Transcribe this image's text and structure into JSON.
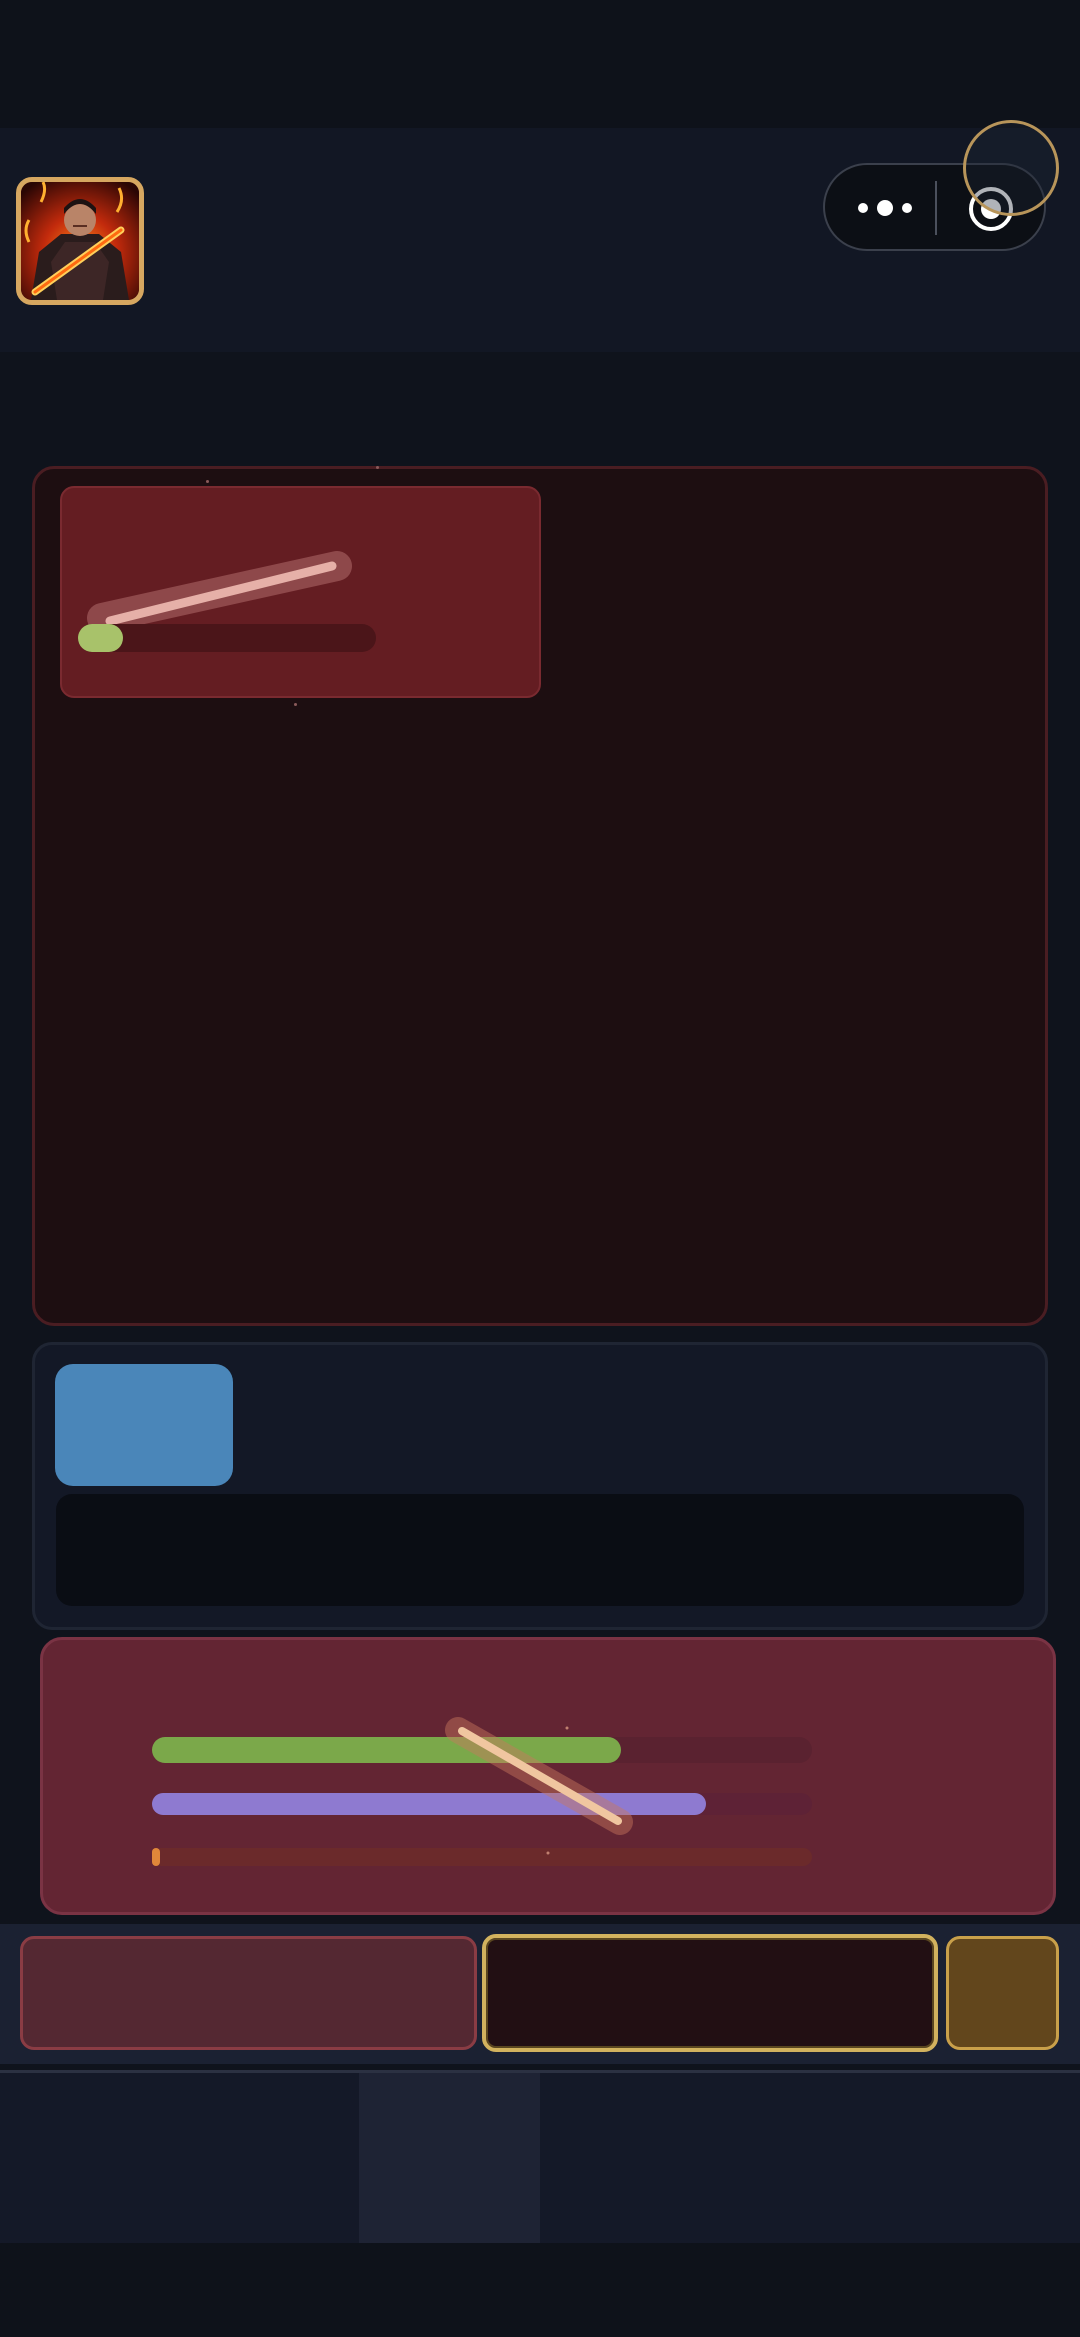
{
  "header": {
    "avatar_icon": "warrior-portrait-icon",
    "capsule": {
      "menu_icon": "more-dots-icon",
      "close_icon": "target-circle-icon"
    }
  },
  "colors": {
    "background": "#0f131c",
    "battle_panel": "#1d0e11",
    "enemy_card": "#641d22",
    "info_chip": "#4a86b9",
    "player_panel": "#632533",
    "hp": "#7ba84a",
    "mp": "#8e7ad0",
    "xp": "#e0873a",
    "gold_border": "#d2b25e"
  },
  "enemy": {
    "hp_fraction": 0.15
  },
  "player": {
    "hp_fraction": 0.71,
    "mp_fraction": 0.84,
    "xp_fraction": 0.01
  },
  "navigation": {
    "active_index": 1
  }
}
